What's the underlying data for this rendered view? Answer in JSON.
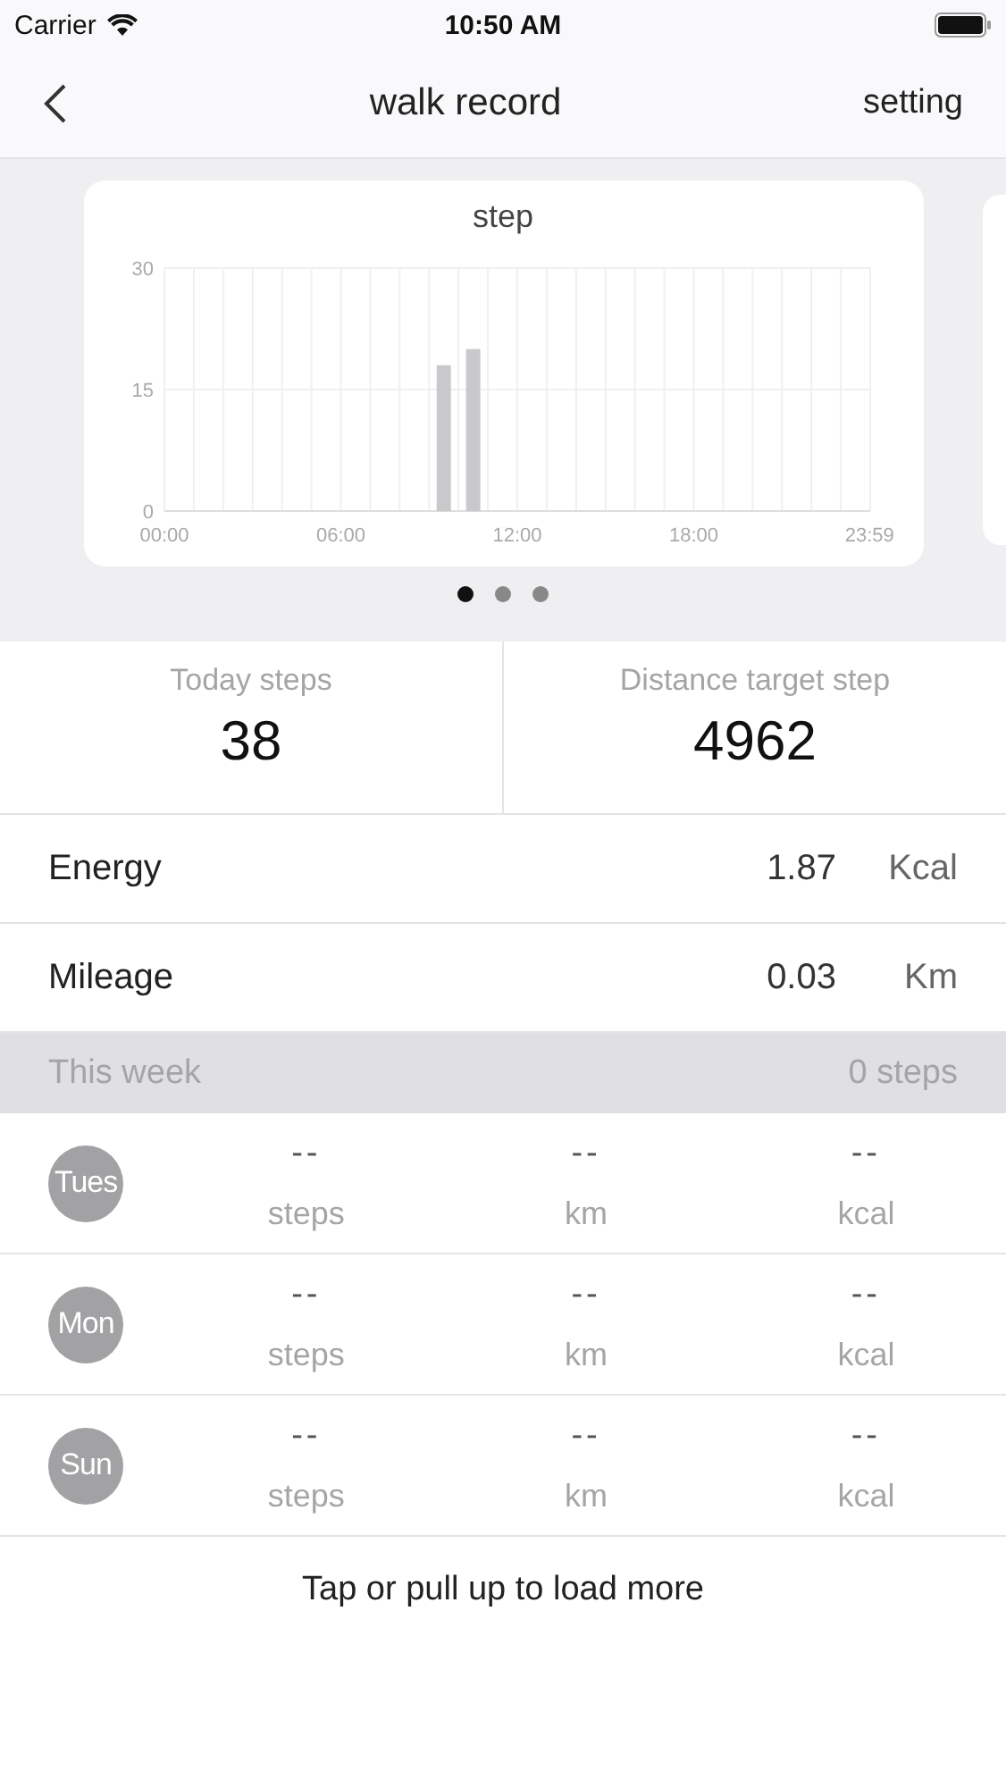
{
  "status_bar": {
    "carrier": "Carrier",
    "time": "10:50 AM"
  },
  "nav": {
    "title": "walk record",
    "action": "setting"
  },
  "chart_card": {
    "title": "step",
    "chart_data": {
      "type": "bar",
      "grid": true,
      "x": [
        9.5,
        10.5
      ],
      "values": [
        18,
        20
      ],
      "xlim": [
        0,
        24
      ],
      "ylim": [
        0,
        30
      ],
      "yticks": [
        0,
        15,
        30
      ],
      "xticks": [
        {
          "value": 0,
          "label": "00:00"
        },
        {
          "value": 6,
          "label": "06:00"
        },
        {
          "value": 12,
          "label": "12:00"
        },
        {
          "value": 18,
          "label": "18:00"
        },
        {
          "value": 23.98,
          "label": "23:59"
        }
      ]
    }
  },
  "pager": [
    {
      "selected": true
    },
    {
      "selected": false
    },
    {
      "selected": false
    }
  ],
  "stats": [
    {
      "label": "Today steps",
      "value": "38"
    },
    {
      "label": "Distance target step",
      "value": "4962"
    }
  ],
  "metrics": [
    {
      "label": "Energy",
      "value": "1.87",
      "unit": "Kcal"
    },
    {
      "label": "Mileage",
      "value": "0.03",
      "unit": "Km"
    }
  ],
  "week": {
    "title": "This week",
    "total": "0 steps",
    "days": [
      {
        "day": "Tues",
        "steps": "--",
        "steps_unit": "steps",
        "km": "--",
        "km_unit": "km",
        "kcal": "--",
        "kcal_unit": "kcal"
      },
      {
        "day": "Mon",
        "steps": "--",
        "steps_unit": "steps",
        "km": "--",
        "km_unit": "km",
        "kcal": "--",
        "kcal_unit": "kcal"
      },
      {
        "day": "Sun",
        "steps": "--",
        "steps_unit": "steps",
        "km": "--",
        "km_unit": "km",
        "kcal": "--",
        "kcal_unit": "kcal"
      }
    ]
  },
  "load_more": "Tap or pull up to load more"
}
